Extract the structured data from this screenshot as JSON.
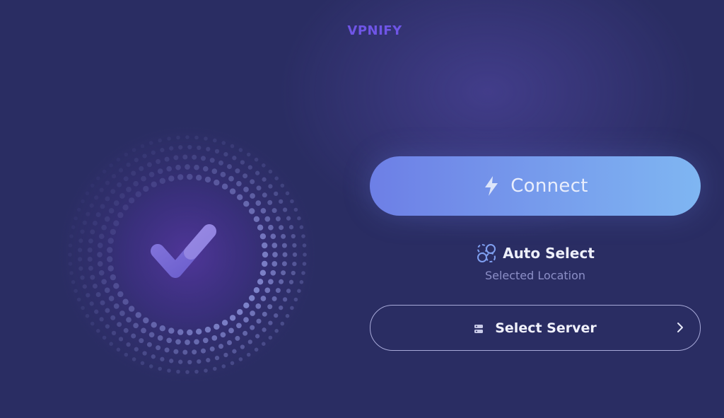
{
  "app": {
    "brand": "VPNIFY"
  },
  "status": {
    "indicator_icon": "checkmark-icon"
  },
  "connect": {
    "label": "Connect",
    "icon": "lightning-bolt-icon"
  },
  "location": {
    "name": "Auto Select",
    "caption": "Selected Location",
    "icon": "auto-select-icon"
  },
  "server": {
    "label": "Select Server",
    "icon": "server-icon",
    "chevron": "chevron-right-icon"
  },
  "colors": {
    "background": "#2a2d63",
    "brand": "#6f55e6",
    "connect_gradient_start": "#6d7fe6",
    "connect_gradient_end": "#7fb6f2",
    "check_primary": "#7a6fd6",
    "check_accent": "#a88fe6"
  }
}
